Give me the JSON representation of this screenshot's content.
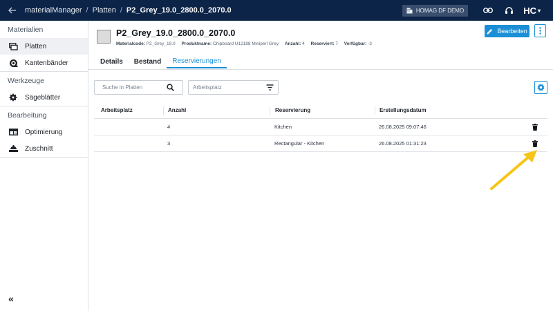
{
  "topbar": {
    "back_icon": "arrow-left-icon",
    "breadcrumbs": [
      "materialManager",
      "Platten",
      "P2_Grey_19.0_2800.0_2070.0"
    ],
    "separator": "/",
    "tenant": "HOMAG DF DEMO",
    "brand": "HC",
    "brand_caret": "▾"
  },
  "sidebar": {
    "sections": [
      {
        "title": "Materialien",
        "items": [
          {
            "label": "Platten",
            "icon": "boards-icon",
            "active": true
          },
          {
            "label": "Kantenbänder",
            "icon": "edgeband-roll-icon"
          }
        ]
      },
      {
        "title": "Werkzeuge",
        "items": [
          {
            "label": "Sägeblätter",
            "icon": "saw-blade-icon"
          }
        ]
      },
      {
        "title": "Bearbeitung",
        "items": [
          {
            "label": "Optimierung",
            "icon": "optimization-icon"
          },
          {
            "label": "Zuschnitt",
            "icon": "cutting-icon"
          }
        ]
      }
    ],
    "collapse": "«"
  },
  "material": {
    "title": "P2_Grey_19.0_2800.0_2070.0",
    "swatch_color": "#dcdcdc",
    "meta": {
      "code_label": "Materialcode:",
      "code": "P2_Grey_19.0",
      "product_label": "Produktname:",
      "product": "Chipboard U12188 Miniperl Grey",
      "count_label": "Anzahl:",
      "count": "4",
      "reserved_label": "Reserviert:",
      "reserved": "7",
      "available_label": "Verfügbar:",
      "available": "-3"
    }
  },
  "actions": {
    "edit_label": "Bearbeiten"
  },
  "tabs": [
    {
      "label": "Details",
      "active": false
    },
    {
      "label": "Bestand",
      "active": false
    },
    {
      "label": "Reservierungen",
      "active": true
    }
  ],
  "filters": {
    "search_placeholder": "Suche in Platten",
    "workplace_placeholder": "Arbeitsplatz"
  },
  "table": {
    "columns": [
      "Arbeitsplatz",
      "Anzahl",
      "Reservierung",
      "Erstellungsdatum"
    ],
    "rows": [
      {
        "workplace": "",
        "count": "4",
        "reservation": "Kitchen",
        "created": "26.08.2025 09:07:46"
      },
      {
        "workplace": "",
        "count": "3",
        "reservation": "Rectangular - Kitchen",
        "created": "26.08.2025 01:31:23"
      }
    ]
  },
  "colors": {
    "topbar": "#0c2447",
    "accent": "#1a8fd6",
    "annotation_arrow": "#f5c518"
  }
}
